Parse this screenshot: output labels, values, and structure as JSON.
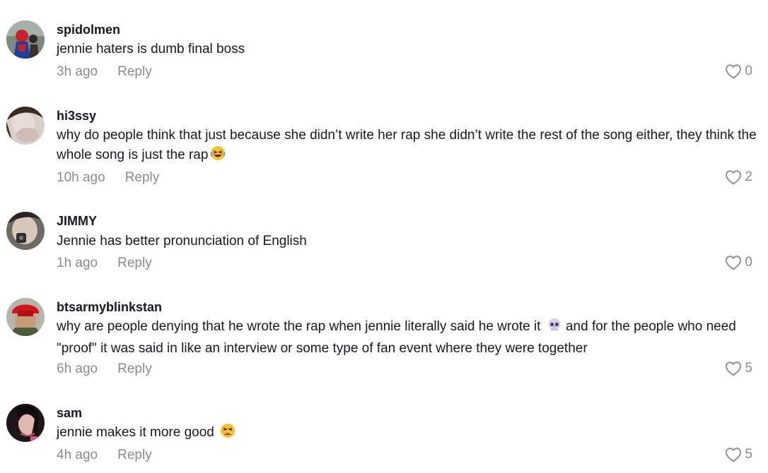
{
  "comments": [
    {
      "username": "spidolmen",
      "text": "jennie haters is dumb final boss",
      "time": "3h ago",
      "reply_label": "Reply",
      "likes": "0",
      "avatar": "spiderman-avatar"
    },
    {
      "username": "hi3ssy",
      "text": "why do people think that just because she didn’t write her rap she didn’t write the rest of the song either, they think the whole song is just the rap",
      "emoji": "laughing-face-emoji",
      "time": "10h ago",
      "reply_label": "Reply",
      "likes": "2",
      "avatar": "blurred-face-avatar"
    },
    {
      "username": "JIMMY",
      "text": "Jennie has better pronunciation of English",
      "time": "1h ago",
      "reply_label": "Reply",
      "likes": "0",
      "avatar": "face-closeup-avatar"
    },
    {
      "username": "btsarmyblinkstan",
      "text_before": "why are people denying that he wrote the rap when jennie literally said he wrote it",
      "emoji": "skull-emoji",
      "text_after": "and for the people who need \"proof\" it was said in like an interview or some type of fan event where they were together",
      "time": "6h ago",
      "reply_label": "Reply",
      "likes": "5",
      "avatar": "red-hat-avatar"
    },
    {
      "username": "sam",
      "text": "jennie makes it more good",
      "emoji": "tired-face-emoji",
      "time": "4h ago",
      "reply_label": "Reply",
      "likes": "5",
      "avatar": "dark-hair-avatar"
    }
  ],
  "colors": {
    "text": "#161823",
    "muted": "#8a8b91"
  }
}
